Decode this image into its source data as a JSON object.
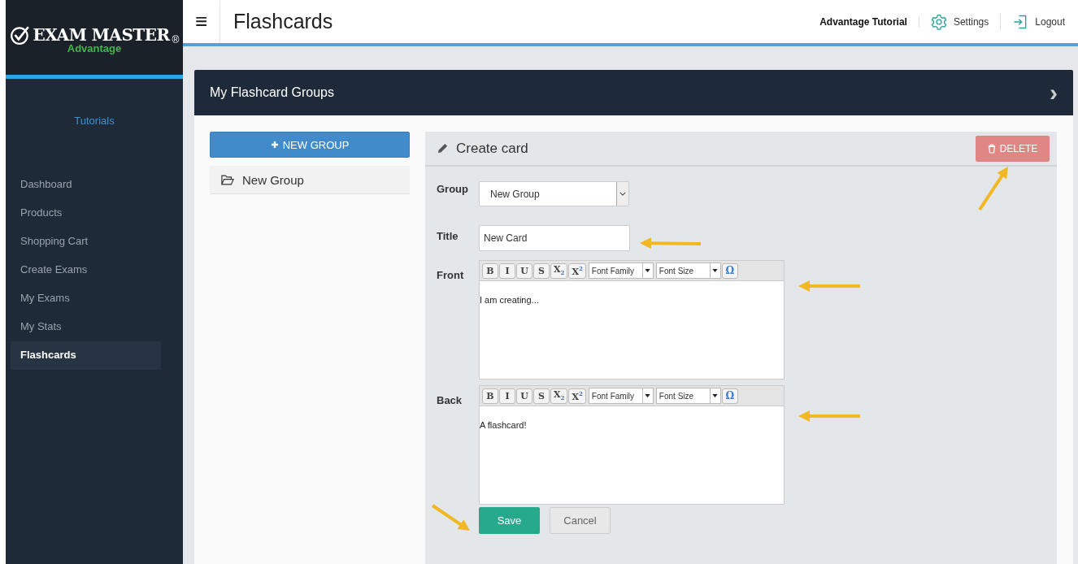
{
  "logo": {
    "title": "EXAM MASTER",
    "registered": "®",
    "subtitle": "Advantage"
  },
  "sidebar": {
    "tutorials_link": "Tutorials",
    "items": [
      {
        "label": "Dashboard",
        "selected": false
      },
      {
        "label": "Products",
        "selected": false
      },
      {
        "label": "Shopping Cart",
        "selected": false
      },
      {
        "label": "Create Exams",
        "selected": false
      },
      {
        "label": "My Exams",
        "selected": false
      },
      {
        "label": "My Stats",
        "selected": false
      },
      {
        "label": "Flashcards",
        "selected": true
      }
    ]
  },
  "header": {
    "menu_glyph": "≡",
    "title": "Flashcards",
    "user": "Advantage Tutorial",
    "settings": "Settings",
    "logout": "Logout"
  },
  "panel": {
    "title": "My Flashcard Groups",
    "chevron": "›"
  },
  "groups": {
    "new_button": "NEW GROUP",
    "items": [
      {
        "label": "New Group"
      }
    ]
  },
  "card": {
    "title": "Create card",
    "delete_button": "DELETE",
    "group": {
      "label": "Group",
      "value": "New Group"
    },
    "title_field": {
      "label": "Title",
      "value": "New Card"
    },
    "editors": [
      {
        "label": "Front",
        "content": "I am creating...",
        "toolbar": {
          "buttons": [
            "B",
            "I",
            "U",
            "S",
            "X$_{2}$",
            "X$^{2}$"
          ],
          "font_family": "Font Family",
          "font_size": "Font Size",
          "special_char": "Ω"
        }
      },
      {
        "label": "Back",
        "content": "A flashcard!",
        "toolbar": {
          "buttons": [
            "B",
            "I",
            "U",
            "S",
            "X$_{2}$",
            "X$^{2}$"
          ],
          "font_family": "Font Family",
          "font_size": "Font Size",
          "special_char": "Ω"
        }
      }
    ],
    "save_button": "Save",
    "cancel_button": "Cancel"
  }
}
